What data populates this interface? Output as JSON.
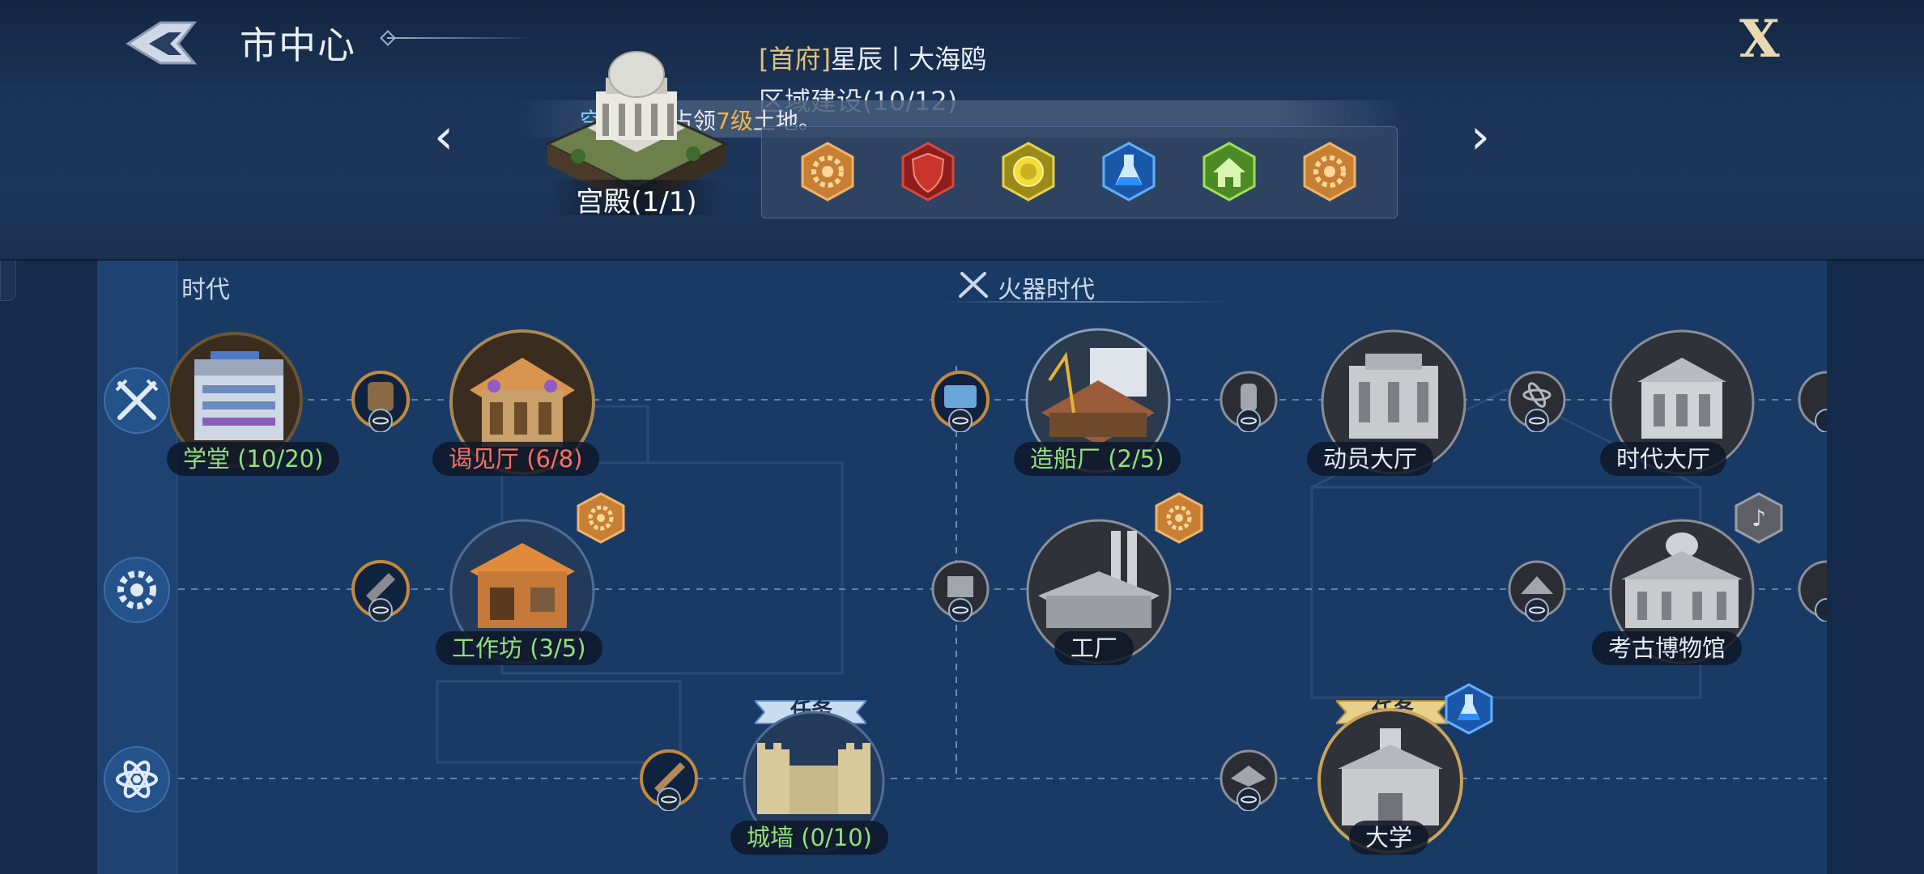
{
  "header": {
    "title": "市中心",
    "close_label": "X"
  },
  "city_info": {
    "owner_prefix": "[首府]",
    "owner": "星辰丨大海鸥",
    "district": "区域建设(10/12)",
    "notice_name": "空空",
    "notice_mid": "成功占领",
    "notice_level": "7级",
    "notice_tail": "土地。",
    "palace_label": "宫殿(1/1)"
  },
  "bonus_icons": [
    "gear-bronze",
    "shield-red",
    "coin-yellow",
    "flask-blue",
    "house-green",
    "gear-bronze"
  ],
  "eras": {
    "left": "时代",
    "right": "火器时代"
  },
  "rail": [
    "crossed-swords",
    "gear",
    "atom"
  ],
  "buildings": {
    "school": "学堂 (10/20)",
    "audience_hall": "谒见厅 (6/8)",
    "shipyard": "造船厂 (2/5)",
    "mobilization_hall": "动员大厅",
    "era_hall": "时代大厅",
    "workshop": "工作坊 (3/5)",
    "factory": "工厂",
    "archaeology_museum": "考古博物馆",
    "city_wall": "城墙 (0/10)",
    "university": "大学"
  },
  "mission_label": "任务",
  "colors": {
    "background": "#1a3a66",
    "header": "#142743",
    "accent_gold": "#e0c07a",
    "complete_green": "#96e07a",
    "warning_red": "#ff6f62",
    "notice_blue": "#7fd0ff",
    "level_orange": "#f2b544"
  }
}
